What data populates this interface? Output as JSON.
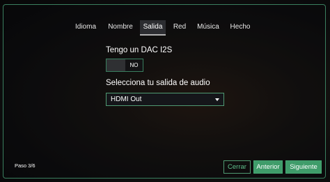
{
  "tabs": [
    {
      "label": "Idioma"
    },
    {
      "label": "Nombre"
    },
    {
      "label": "Salida",
      "active": true
    },
    {
      "label": "Red"
    },
    {
      "label": "Música"
    },
    {
      "label": "Hecho"
    }
  ],
  "dac": {
    "label": "Tengo un DAC I2S",
    "toggle_state": "NO",
    "enabled": false
  },
  "audio_output": {
    "label": "Selecciona tu salida de audio",
    "selected": "HDMI Out"
  },
  "footer": {
    "step": "Paso 3/6",
    "cancel": "Cerrar",
    "previous": "Anterior",
    "next": "Siguiente"
  },
  "colors": {
    "accent": "#3f9c6a",
    "accent_border": "#3a7f5f",
    "accent_text": "#5fc08c",
    "tab_active_bg": "#2c2d31"
  }
}
